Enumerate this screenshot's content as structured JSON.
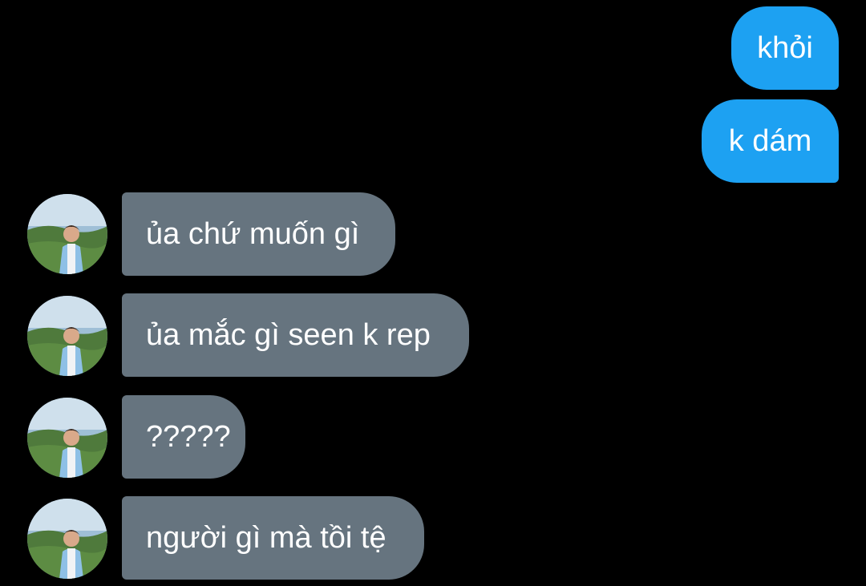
{
  "colors": {
    "background": "#000000",
    "sent_bubble": "#1da1f2",
    "received_bubble": "#66747f",
    "text": "#ffffff"
  },
  "messages": [
    {
      "direction": "sent",
      "text": "khỏi"
    },
    {
      "direction": "sent",
      "text": "k dám"
    },
    {
      "direction": "received",
      "text": "ủa chứ muốn gì",
      "avatar": "profile-photo"
    },
    {
      "direction": "received",
      "text": "ủa mắc gì seen k rep",
      "avatar": "profile-photo"
    },
    {
      "direction": "received",
      "text": "?????",
      "avatar": "profile-photo"
    },
    {
      "direction": "received",
      "text": "người gì mà tồi tệ",
      "avatar": "profile-photo"
    }
  ]
}
